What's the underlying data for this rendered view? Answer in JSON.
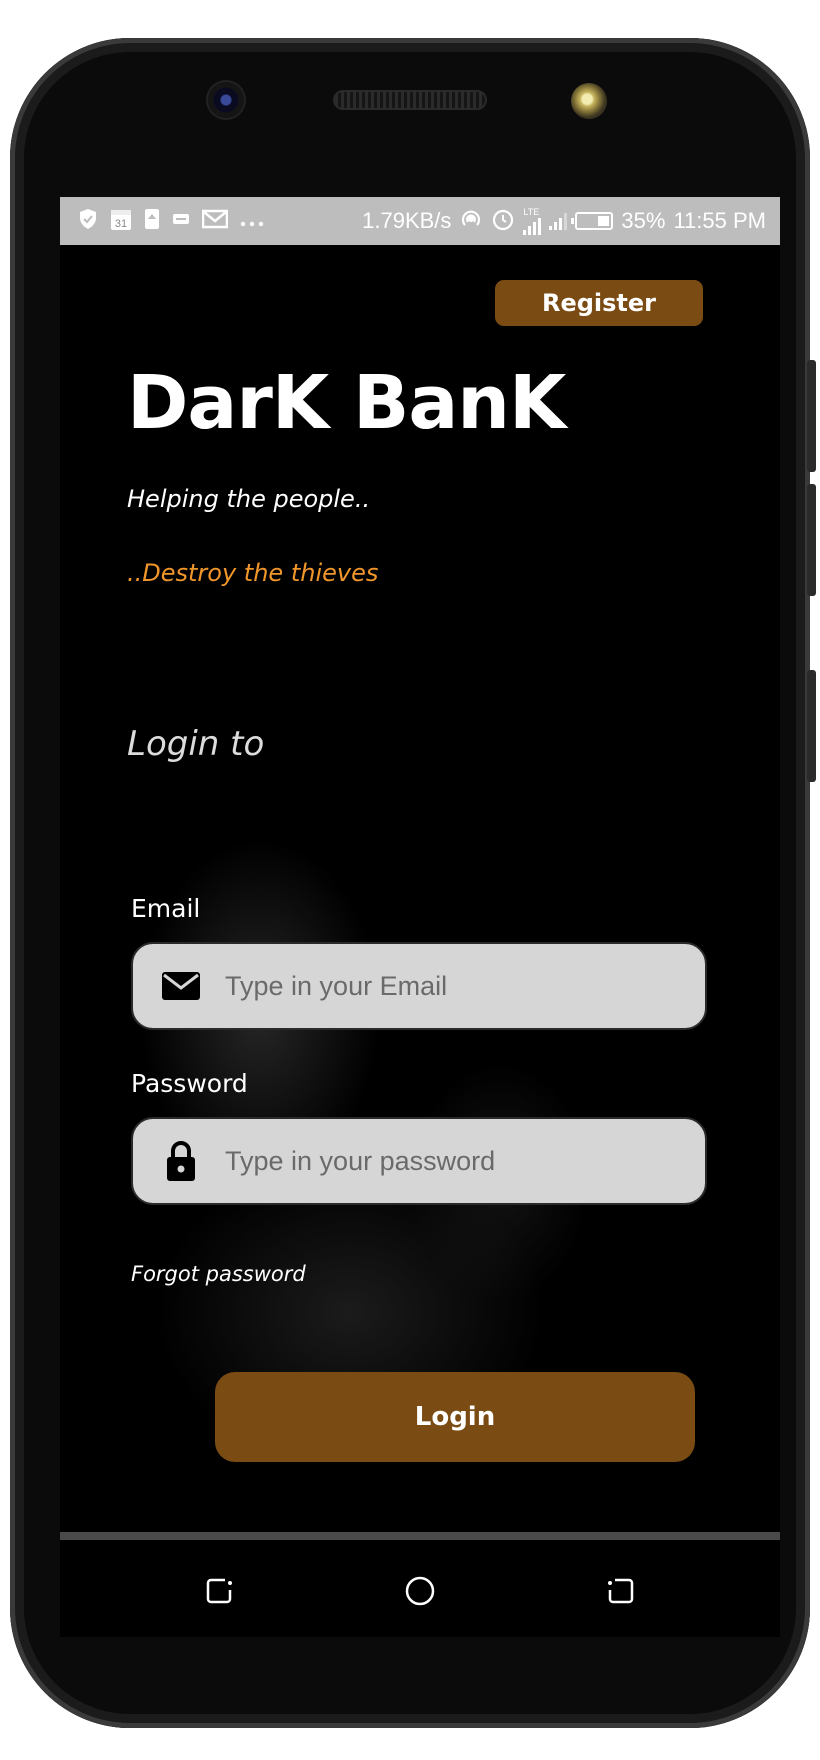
{
  "status_bar": {
    "net_speed": "1.79KB/s",
    "calendar_day": "31",
    "network_type": "LTE",
    "battery_percent": "35%",
    "time": "11:55 PM",
    "battery_level": 0.35
  },
  "app": {
    "register_label": "Register",
    "brand_title": "DarK BanK",
    "tagline_1": "Helping the people..",
    "tagline_2": "..Destroy the thieves",
    "login_heading": "Login to",
    "email_label": "Email",
    "email_placeholder": "Type in your Email",
    "password_label": "Password",
    "password_placeholder": "Type in your password",
    "forgot_password": "Forgot password",
    "login_label": "Login"
  },
  "colors": {
    "accent": "#7a4c14",
    "tagline_accent": "#f0962a",
    "field_bg": "#d6d6d6",
    "status_bar_bg": "#bdbdbd"
  },
  "icons": {
    "email": "envelope-icon",
    "password": "lock-icon",
    "nav_back": "back-icon",
    "nav_home": "home-icon",
    "nav_recents": "recents-icon"
  }
}
